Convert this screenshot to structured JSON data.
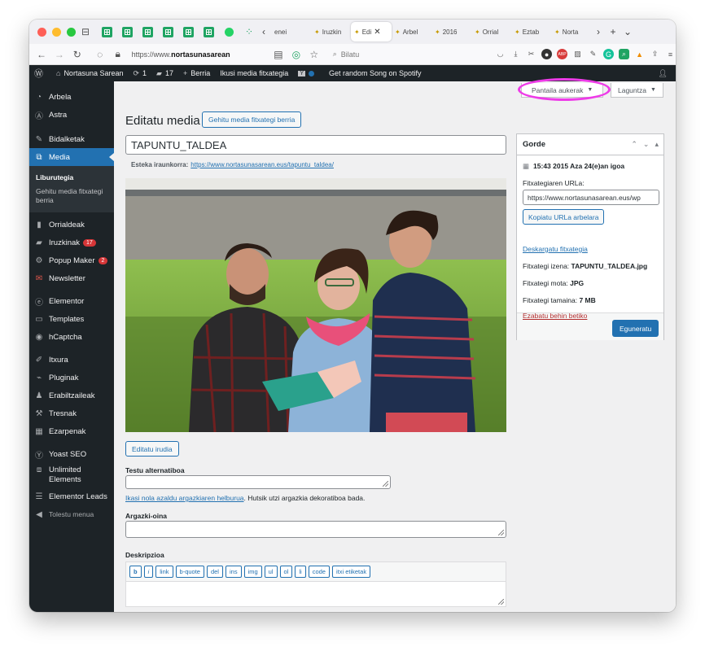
{
  "browser": {
    "tabs": [
      {
        "label": "enei"
      },
      {
        "label": "Iruzkin"
      },
      {
        "label": "Edi",
        "active": true
      },
      {
        "label": "Arbel"
      },
      {
        "label": "2016"
      },
      {
        "label": "Orrial"
      },
      {
        "label": "Eztab"
      },
      {
        "label": "Norta"
      }
    ],
    "url_prefix": "https://www.",
    "url_domain": "nortasunasarean",
    "search_placeholder": "Bilatu",
    "extension_labels": {
      "abp": "ABP"
    }
  },
  "adminbar": {
    "site_name": "Nortasuna Sarean",
    "updates_count": "1",
    "comments_count": "17",
    "new_label": "Berria",
    "view_media_label": "Ikusi media fitxategia",
    "spotify_label": "Get random Song on Spotify"
  },
  "sidebar": {
    "items": [
      {
        "label": "Arbela",
        "icon": "dashboard-icon"
      },
      {
        "label": "Astra",
        "icon": "astra-icon"
      },
      {
        "label": "Bidalketak",
        "icon": "pin-icon"
      },
      {
        "label": "Media",
        "icon": "media-icon",
        "current": true
      },
      {
        "label": "Orrialdeak",
        "icon": "pages-icon"
      },
      {
        "label": "Iruzkinak",
        "icon": "comments-icon",
        "badge": "17"
      },
      {
        "label": "Popup Maker",
        "icon": "popup-icon",
        "badge": "2"
      },
      {
        "label": "Newsletter",
        "icon": "newsletter-icon"
      },
      {
        "label": "Elementor",
        "icon": "elementor-icon"
      },
      {
        "label": "Templates",
        "icon": "folder-icon"
      },
      {
        "label": "hCaptcha",
        "icon": "hcaptcha-icon"
      },
      {
        "label": "Itxura",
        "icon": "brush-icon"
      },
      {
        "label": "Pluginak",
        "icon": "plugin-icon"
      },
      {
        "label": "Erabiltzaileak",
        "icon": "user-icon"
      },
      {
        "label": "Tresnak",
        "icon": "wrench-icon"
      },
      {
        "label": "Ezarpenak",
        "icon": "settings-icon"
      },
      {
        "label": "Yoast SEO",
        "icon": "yoast-icon"
      },
      {
        "label": "Unlimited Elements",
        "icon": "unlimited-icon"
      },
      {
        "label": "Elementor Leads",
        "icon": "leads-icon"
      },
      {
        "label": "Tolestu menua",
        "icon": "collapse-icon"
      }
    ],
    "media_submenu": [
      {
        "label": "Liburutegia",
        "current": true
      },
      {
        "label": "Gehitu media fitxategi berria"
      }
    ]
  },
  "main": {
    "screen_options_label": "Pantaila aukerak",
    "help_label": "Laguntza",
    "page_title": "Editatu media",
    "add_new_label": "Gehitu media fitxategi berria",
    "title_value": "TAPUNTU_TALDEA",
    "permalink_label": "Esteka iraunkorra:",
    "permalink_url": "https://www.nortasunasarean.eus/tapuntu_taldea/",
    "edit_image_label": "Editatu irudia",
    "alt_label": "Testu alternatiboa",
    "alt_help_link": "Ikasi nola azaldu argazkiaren helburua",
    "alt_help_text": ". Hutsik utzi argazkia dekoratiboa bada.",
    "caption_label": "Argazki-oina",
    "description_label": "Deskripzioa",
    "quicktags": [
      "b",
      "i",
      "link",
      "b-quote",
      "del",
      "ins",
      "img",
      "ul",
      "ol",
      "li",
      "code",
      "itxi etiketak"
    ]
  },
  "savebox": {
    "title": "Gorde",
    "uploaded_on": "15:43 2015 Aza 24(e)an igoa",
    "file_url_label": "Fitxategiaren URLa:",
    "file_url_value": "https://www.nortasunasarean.eus/wp",
    "copy_url_label": "Kopiatu URLa arbelara",
    "download_label": "Deskargatu fitxategia",
    "filename_label": "Fitxategi izena:",
    "filename_value": "TAPUNTU_TALDEA.jpg",
    "filetype_label": "Fitxategi mota:",
    "filetype_value": "JPG",
    "filesize_label": "Fitxategi tamaina:",
    "filesize_value": "7 MB",
    "delete_label": "Ezabatu behin betiko",
    "update_label": "Eguneratu"
  },
  "colors": {
    "wp_blue": "#2271b1",
    "admin_dark": "#1d2327",
    "highlight_ring": "#ee3be8",
    "delete_red": "#b32d2e"
  }
}
